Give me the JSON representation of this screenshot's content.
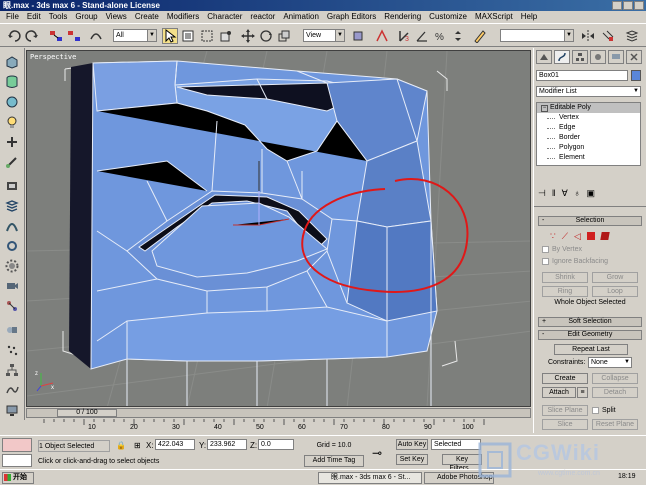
{
  "window": {
    "title": "眼.max - 3ds max 6 - Stand-alone License"
  },
  "menu": [
    "File",
    "Edit",
    "Tools",
    "Group",
    "Views",
    "Create",
    "Modifiers",
    "Character",
    "reactor",
    "Animation",
    "Graph Editors",
    "Rendering",
    "Customize",
    "MAXScript",
    "Help"
  ],
  "toolbar": {
    "selection_filter": "All",
    "reference_coord": "View"
  },
  "viewport": {
    "label": "Perspective"
  },
  "command_panel": {
    "object_name": "Box01",
    "modifier_list": "Modifier List",
    "stack": {
      "base": "Editable Poly",
      "subobjects": [
        "Vertex",
        "Edge",
        "Border",
        "Polygon",
        "Element"
      ]
    },
    "selection": {
      "title": "Selection",
      "by_vertex": "By Vertex",
      "ignore_backfacing": "Ignore Backfacing",
      "shrink": "Shrink",
      "grow": "Grow",
      "ring": "Ring",
      "loop": "Loop",
      "status": "Whole Object Selected"
    },
    "soft_selection": {
      "title": "Soft Selection"
    },
    "edit_geometry": {
      "title": "Edit Geometry",
      "repeat_last": "Repeat Last",
      "constraints_label": "Constraints:",
      "constraints_value": "None",
      "create": "Create",
      "collapse": "Collapse",
      "attach": "Attach",
      "detach": "Detach",
      "slice_plane": "Slice Plane",
      "split": "Split",
      "slice": "Slice",
      "reset_plane": "Reset Plane"
    },
    "rollout_signs": {
      "open": "-",
      "closed": "+"
    }
  },
  "timeline": {
    "slider": "0 / 100",
    "ticks": [
      "10",
      "20",
      "30",
      "40",
      "50",
      "60",
      "70",
      "80",
      "90",
      "100"
    ]
  },
  "status": {
    "selection": "1 Object Selected",
    "prompt": "Click or click-and-drag to select objects",
    "x_label": "X:",
    "x": "422.043",
    "y_label": "Y:",
    "y": "233.962",
    "z_label": "Z:",
    "z": "0.0",
    "grid": "Grid = 10.0",
    "add_time_tag": "Add Time Tag",
    "auto_key": "Auto Key",
    "set_key": "Set Key",
    "key_filter_value": "Selected",
    "key_filters": "Key Filters..."
  },
  "taskbar": {
    "start": "开始",
    "tasks": [
      "眼.max - 3ds max 6 - St...",
      "Adobe Photoshop"
    ],
    "clock": "18:19"
  },
  "watermark": {
    "logo": "CGWiki",
    "url": "www.cgtime.com.cn"
  },
  "colors": {
    "poly_face": "#6f97dd",
    "annotation": "#e01818",
    "selected_toolbar": "#f4e08a",
    "viewport_bg": "#7d7f7c"
  }
}
